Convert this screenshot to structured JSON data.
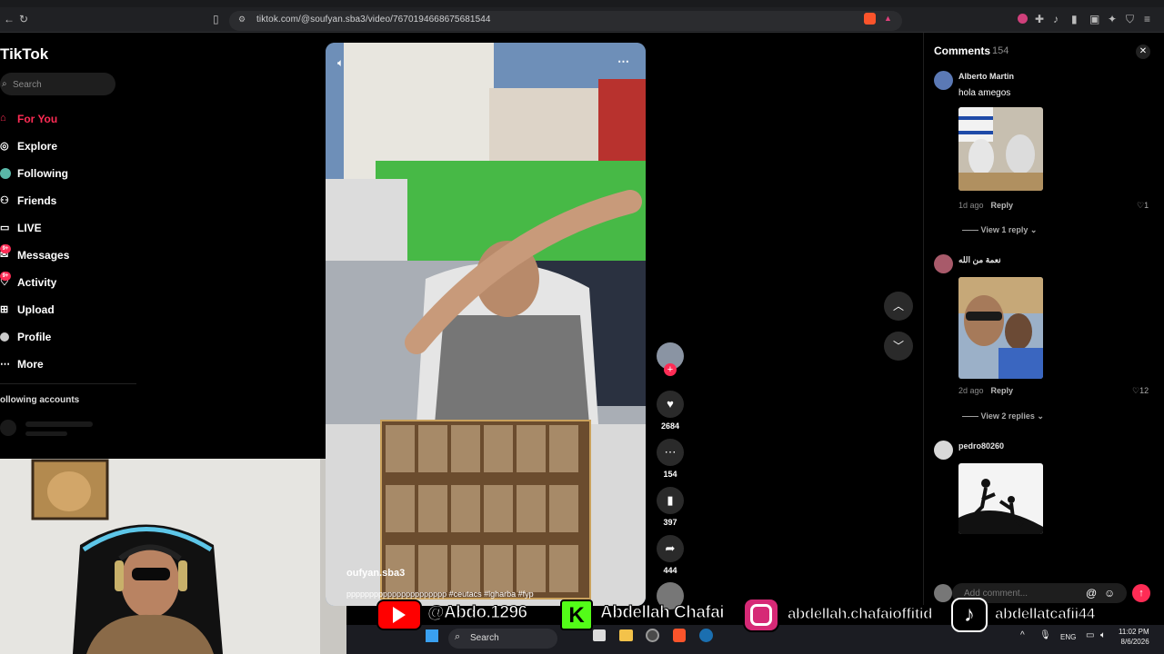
{
  "browser": {
    "url": "tiktok.com/@soufyan.sba3/video/7670194668675681544"
  },
  "sidebar": {
    "logo": "TikTok",
    "search_placeholder": "Search",
    "items": [
      {
        "label": "For You",
        "icon": "home-icon"
      },
      {
        "label": "Explore",
        "icon": "compass-icon"
      },
      {
        "label": "Following",
        "icon": "following-icon"
      },
      {
        "label": "Friends",
        "icon": "friends-icon"
      },
      {
        "label": "LIVE",
        "icon": "live-icon"
      },
      {
        "label": "Messages",
        "icon": "messages-icon",
        "badge": "9+"
      },
      {
        "label": "Activity",
        "icon": "activity-icon",
        "badge": "9+"
      },
      {
        "label": "Upload",
        "icon": "upload-icon"
      },
      {
        "label": "Profile",
        "icon": "profile-icon"
      },
      {
        "label": "More",
        "icon": "more-icon"
      }
    ],
    "following_accounts_label": "ollowing accounts"
  },
  "video": {
    "author": "oufyan.sba3",
    "caption": "pppppppppppppppppppppp #ceutacs #lgharba #fyp",
    "likes": "2684",
    "comments": "154",
    "saves": "397",
    "shares": "444"
  },
  "comments_panel": {
    "title": "Comments",
    "count": "154",
    "items": [
      {
        "user": "Alberto Martin",
        "text": "hola amegos",
        "time": "1d ago",
        "reply": "Reply",
        "likes": "1",
        "view_replies": "View 1 reply"
      },
      {
        "user": "نعمة من الله",
        "text": "",
        "time": "2d ago",
        "reply": "Reply",
        "likes": "12",
        "view_replies": "View 2 replies"
      },
      {
        "user": "pedro80260",
        "text": ""
      }
    ],
    "add_placeholder": "Add comment..."
  },
  "overlay": {
    "youtube": "@Abdo.1296",
    "kick": "Abdellah Chafai",
    "instagram": "abdellah.chafaioffitid",
    "tiktok": "abdellatcafii44"
  },
  "taskbar": {
    "search": "Search",
    "language": "ENG",
    "time": "11:02 PM",
    "date": "8/6/2026"
  },
  "colors": {
    "accent": "#fe2c55",
    "background": "#000000"
  }
}
